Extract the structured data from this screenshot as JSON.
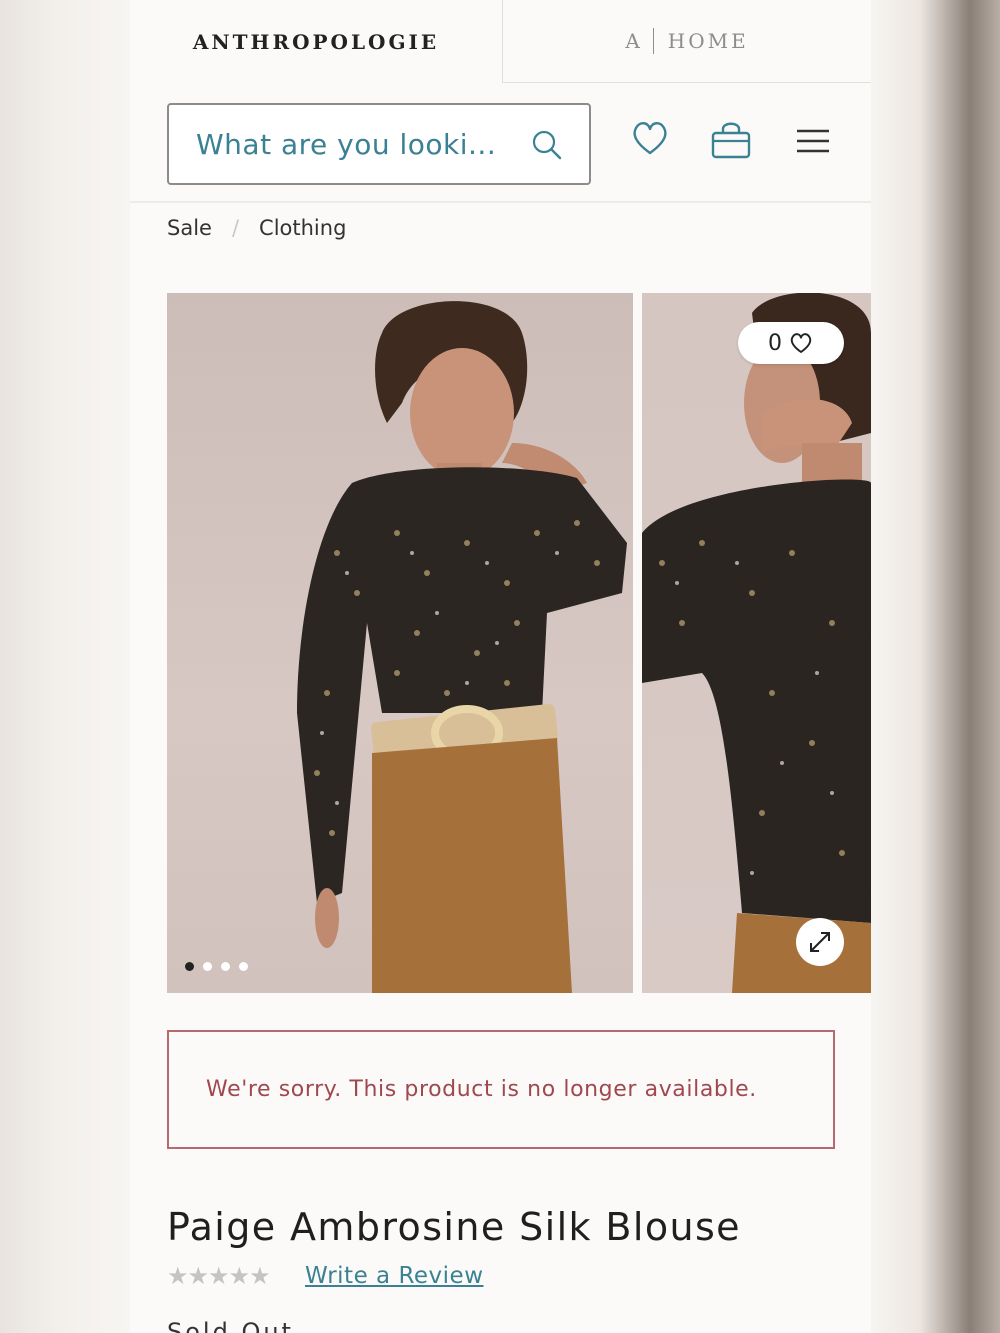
{
  "brand": {
    "main_tab": "ANTHROPOLOGIE",
    "home_tab_prefix": "A",
    "home_tab_label": "HOME"
  },
  "header": {
    "search_placeholder": "What are you looki...",
    "icons": [
      "search-icon",
      "heart-icon",
      "shopping-bag-icon",
      "hamburger-menu-icon"
    ]
  },
  "breadcrumb": {
    "items": [
      "Sale",
      "Clothing"
    ],
    "separator": "/"
  },
  "gallery": {
    "like_count": "0",
    "dot_count": 4,
    "active_dot": 0
  },
  "alert": {
    "message": "We're sorry. This product is no longer available."
  },
  "product": {
    "title": "Paige Ambrosine Silk Blouse",
    "stars": "★★★★★",
    "rating": 0,
    "review_link": "Write a Review",
    "status": "Sold Out"
  },
  "colors": {
    "accent": "#3a8194",
    "alert": "#a0484f",
    "text": "#1f1f1f"
  }
}
